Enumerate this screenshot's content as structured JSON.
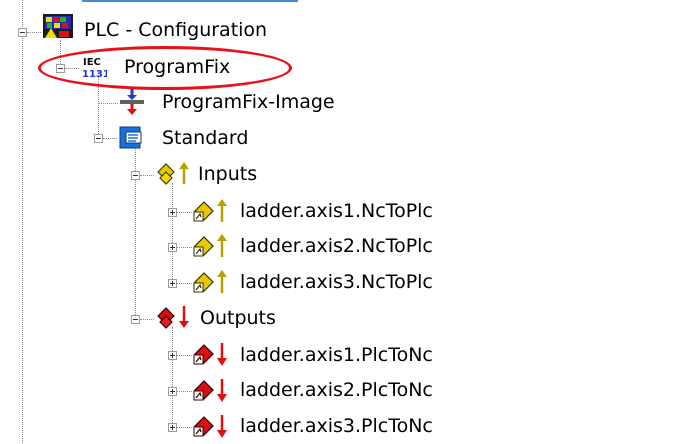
{
  "colors": {
    "highlight": "#e8111b",
    "selection_border": "#4a86d8",
    "input_arrow": "#b8a000",
    "output_arrow": "#e01010",
    "tree_line": "#8a8a8a"
  },
  "tree": {
    "root": {
      "label": "PLC - Configuration",
      "icon": "plc-config-icon",
      "expanded": true
    },
    "program": {
      "label": "ProgramFix",
      "icon": "iec1131-icon",
      "icon_text_top": "IEC",
      "icon_text_bottom": "1131",
      "expanded": true,
      "highlighted": true
    },
    "image": {
      "label": "ProgramFix-Image",
      "icon": "process-image-icon"
    },
    "standard": {
      "label": "Standard",
      "icon": "task-icon",
      "expanded": true
    },
    "inputs": {
      "label": "Inputs",
      "icon": "inputs-icon",
      "expanded": true,
      "items": [
        {
          "label": "ladder.axis1.NcToPlc",
          "icon": "input-variable-icon",
          "expanded": false
        },
        {
          "label": "ladder.axis2.NcToPlc",
          "icon": "input-variable-icon",
          "expanded": false
        },
        {
          "label": "ladder.axis3.NcToPlc",
          "icon": "input-variable-icon",
          "expanded": false
        }
      ]
    },
    "outputs": {
      "label": "Outputs",
      "icon": "outputs-icon",
      "expanded": true,
      "items": [
        {
          "label": "ladder.axis1.PlcToNc",
          "icon": "output-variable-icon",
          "expanded": false
        },
        {
          "label": "ladder.axis2.PlcToNc",
          "icon": "output-variable-icon",
          "expanded": false
        },
        {
          "label": "ladder.axis3.PlcToNc",
          "icon": "output-variable-icon",
          "expanded": false
        }
      ]
    }
  }
}
